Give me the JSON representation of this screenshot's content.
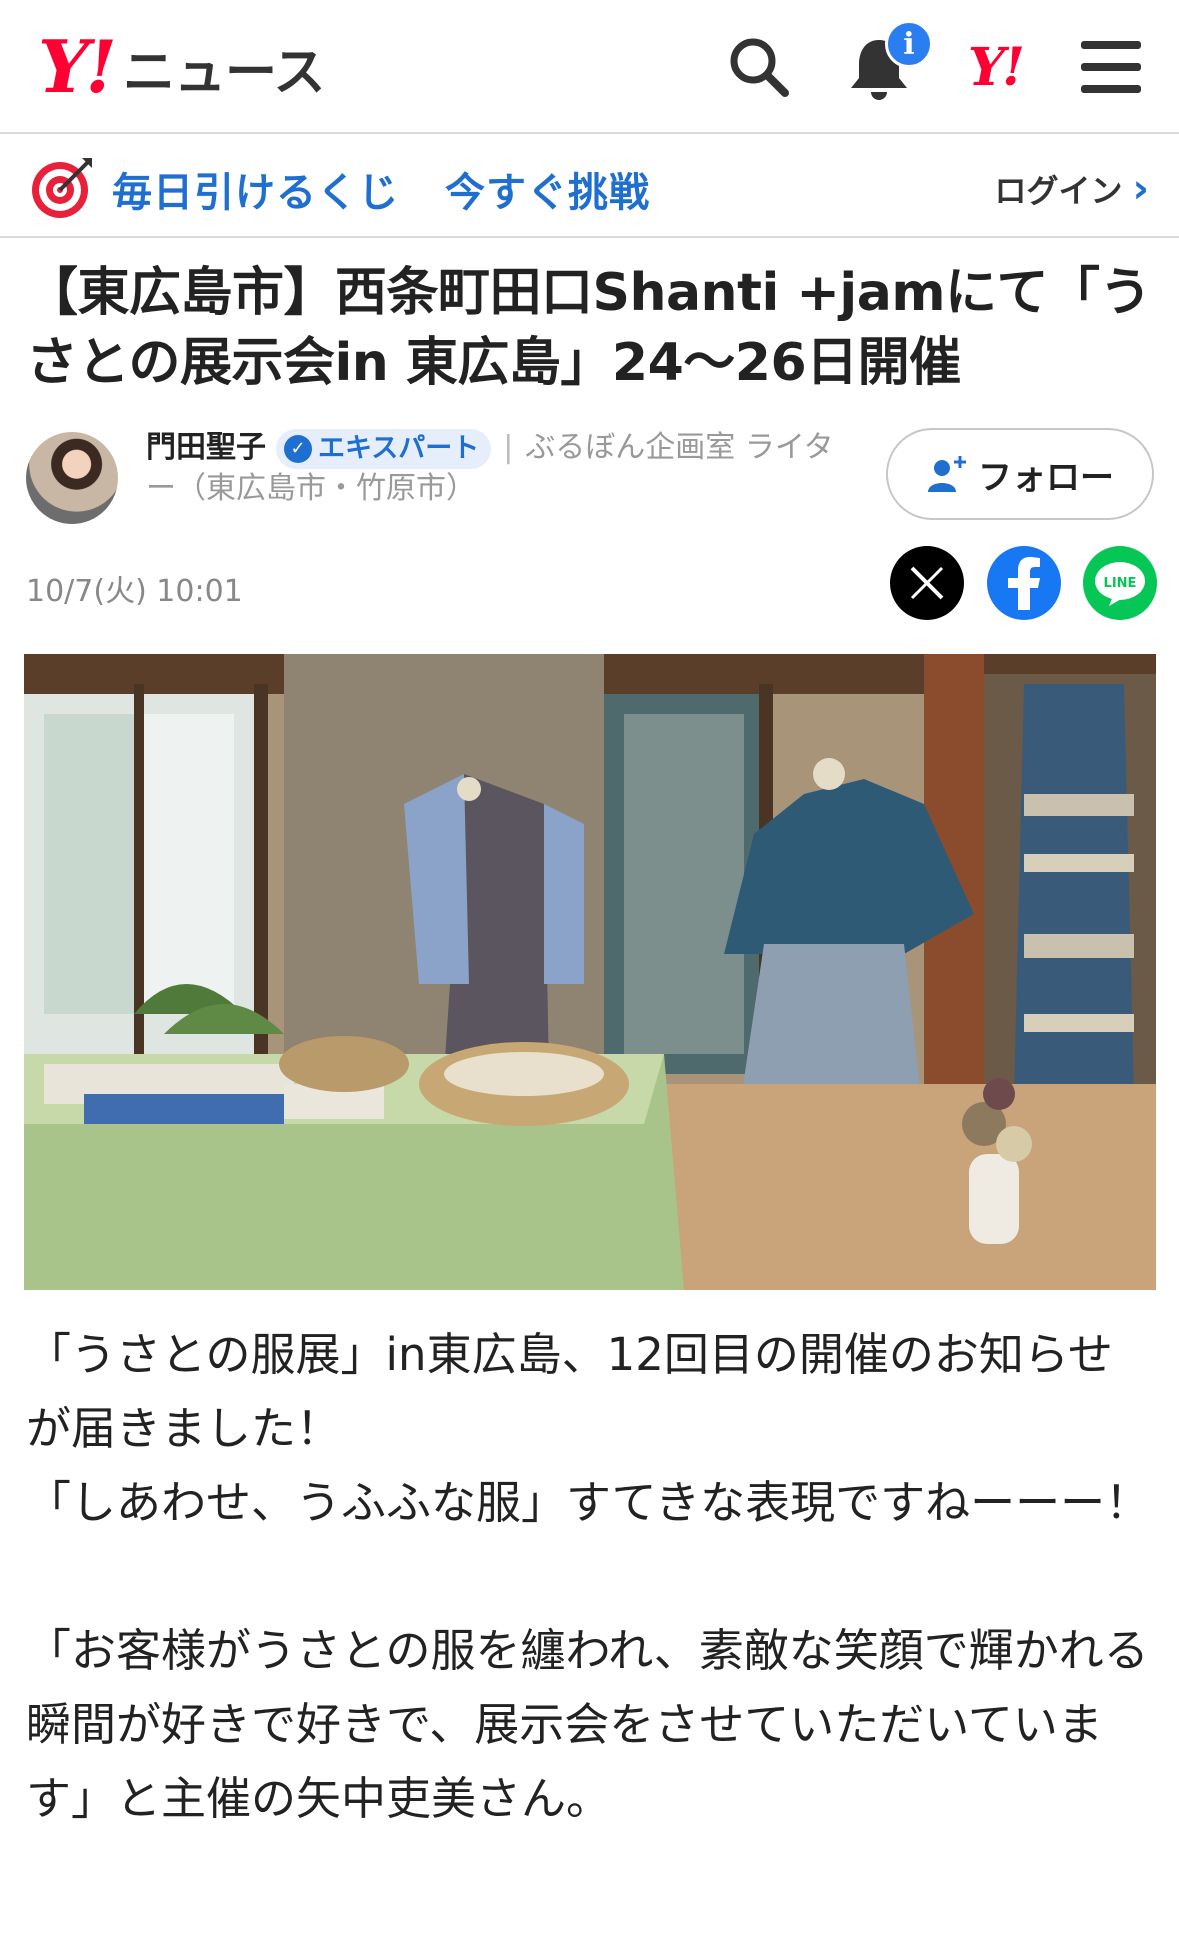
{
  "header": {
    "logo_mark": "Y!",
    "logo_text": "ニュース",
    "notification_badge": "i",
    "yahoo_mark": "Y!"
  },
  "promo": {
    "campaign": "毎日引けるくじ",
    "cta": "今すぐ挑戦",
    "login": "ログイン"
  },
  "article": {
    "title": "【東広島市】西条町田口Shanti +jamにて「うさとの展示会in 東広島」24〜26日開催",
    "author_name": "門田聖子",
    "expert_badge": "エキスパート",
    "author_desc": "ぶるぼん企画室 ライター（東広島市・竹原市）",
    "follow": "フォロー",
    "date": "10/7(火) 10:01",
    "paragraphs": [
      "「うさとの服展」in東広島、12回目の開催のお知らせが届きました！\n「しあわせ、うふふな服」すてきな表現ですねーーー！",
      "「お客様がうさとの服を纏われ、素敵な笑顔で輝かれる瞬間が好きで好きで、展示会をさせていただいています」と主催の矢中吏美さん。"
    ]
  },
  "colors": {
    "yahoo_red": "#ff0033",
    "link_blue": "#1f6fd1",
    "line_green": "#06c755",
    "facebook_blue": "#1877f2"
  }
}
